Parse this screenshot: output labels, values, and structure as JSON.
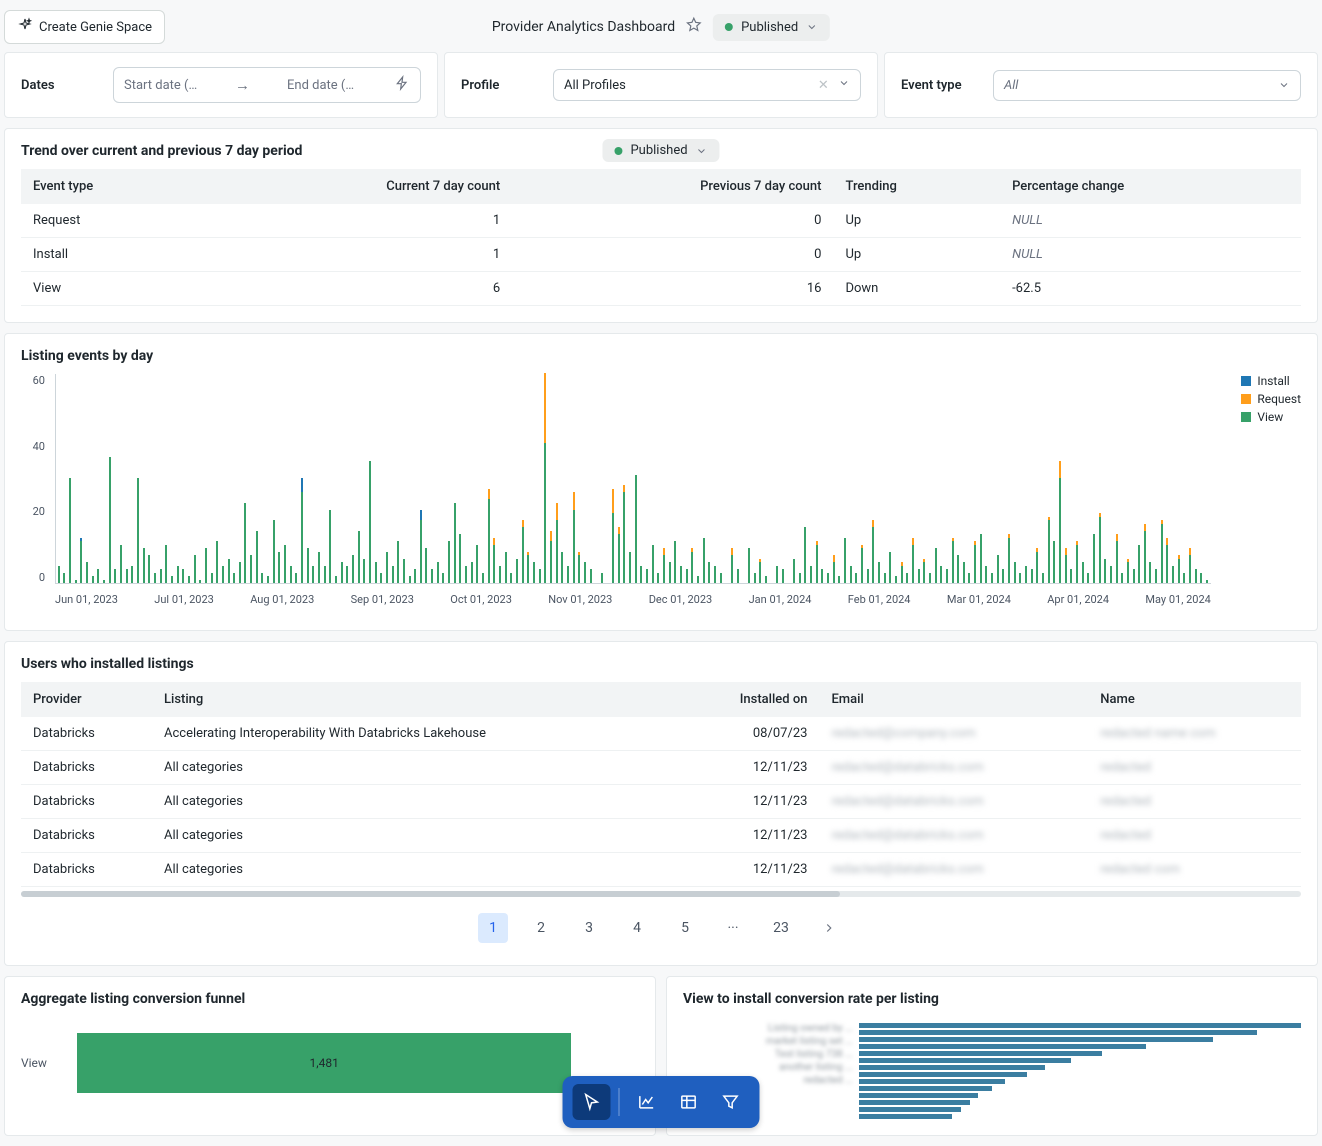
{
  "header": {
    "create_btn": "Create Genie Space",
    "title": "Provider Analytics Dashboard",
    "published": "Published"
  },
  "filters": {
    "dates_label": "Dates",
    "start_placeholder": "Start date (M...",
    "end_placeholder": "End date (M...",
    "profile_label": "Profile",
    "profile_value": "All Profiles",
    "event_type_label": "Event type",
    "event_type_value": "All"
  },
  "trend": {
    "title": "Trend over current and previous 7 day period",
    "published_badge": "Published",
    "headers": [
      "Event type",
      "Current 7 day count",
      "Previous 7 day count",
      "Trending",
      "Percentage change"
    ],
    "rows": [
      {
        "type": "Request",
        "cur": "1",
        "prev": "0",
        "trend": "Up",
        "pct": "NULL"
      },
      {
        "type": "Install",
        "cur": "1",
        "prev": "0",
        "trend": "Up",
        "pct": "NULL"
      },
      {
        "type": "View",
        "cur": "6",
        "prev": "16",
        "trend": "Down",
        "pct": "-62.5"
      }
    ]
  },
  "chart_data": {
    "type": "bar",
    "title": "Listing events by day",
    "ylabel": "",
    "ylim": [
      0,
      60
    ],
    "yticks": [
      0,
      20,
      40,
      60
    ],
    "xticks": [
      "Jun 01, 2023",
      "Jul 01, 2023",
      "Aug 01, 2023",
      "Sep 01, 2023",
      "Oct 01, 2023",
      "Nov 01, 2023",
      "Dec 01, 2023",
      "Jan 01, 2024",
      "Feb 01, 2024",
      "Mar 01, 2024",
      "Apr 01, 2024",
      "May 01, 2024"
    ],
    "legend": [
      "Install",
      "Request",
      "View"
    ],
    "colors": {
      "Install": "#1f77b4",
      "Request": "#ff9e1b",
      "View": "#37a169"
    },
    "series_note": "Daily stacked counts; approximated from chart pixels",
    "data": [
      {
        "v": 5,
        "i": 0,
        "r": 0
      },
      {
        "v": 3,
        "i": 0,
        "r": 0
      },
      {
        "v": 30,
        "i": 0,
        "r": 0
      },
      {
        "v": 1,
        "i": 0,
        "r": 0
      },
      {
        "v": 12,
        "i": 1,
        "r": 0
      },
      {
        "v": 6,
        "i": 0,
        "r": 0
      },
      {
        "v": 2,
        "i": 0,
        "r": 0
      },
      {
        "v": 4,
        "i": 0,
        "r": 0
      },
      {
        "v": 1,
        "i": 0,
        "r": 0
      },
      {
        "v": 36,
        "i": 0,
        "r": 0
      },
      {
        "v": 4,
        "i": 0,
        "r": 0
      },
      {
        "v": 11,
        "i": 0,
        "r": 0
      },
      {
        "v": 4,
        "i": 0,
        "r": 0
      },
      {
        "v": 5,
        "i": 0,
        "r": 0
      },
      {
        "v": 30,
        "i": 0,
        "r": 0
      },
      {
        "v": 10,
        "i": 0,
        "r": 0
      },
      {
        "v": 8,
        "i": 0,
        "r": 0
      },
      {
        "v": 3,
        "i": 0,
        "r": 0
      },
      {
        "v": 4,
        "i": 0,
        "r": 0
      },
      {
        "v": 11,
        "i": 0,
        "r": 0
      },
      {
        "v": 2,
        "i": 0,
        "r": 0
      },
      {
        "v": 5,
        "i": 0,
        "r": 0
      },
      {
        "v": 4,
        "i": 0,
        "r": 0
      },
      {
        "v": 2,
        "i": 0,
        "r": 0
      },
      {
        "v": 8,
        "i": 0,
        "r": 0
      },
      {
        "v": 1,
        "i": 0,
        "r": 0
      },
      {
        "v": 10,
        "i": 0,
        "r": 0
      },
      {
        "v": 3,
        "i": 0,
        "r": 0
      },
      {
        "v": 12,
        "i": 0,
        "r": 0
      },
      {
        "v": 5,
        "i": 0,
        "r": 0
      },
      {
        "v": 7,
        "i": 0,
        "r": 0
      },
      {
        "v": 3,
        "i": 0,
        "r": 0
      },
      {
        "v": 6,
        "i": 0,
        "r": 0
      },
      {
        "v": 23,
        "i": 0,
        "r": 0
      },
      {
        "v": 8,
        "i": 0,
        "r": 0
      },
      {
        "v": 15,
        "i": 0,
        "r": 0
      },
      {
        "v": 3,
        "i": 0,
        "r": 0
      },
      {
        "v": 2,
        "i": 0,
        "r": 0
      },
      {
        "v": 18,
        "i": 0,
        "r": 0
      },
      {
        "v": 9,
        "i": 0,
        "r": 0
      },
      {
        "v": 11,
        "i": 0,
        "r": 0
      },
      {
        "v": 5,
        "i": 0,
        "r": 0
      },
      {
        "v": 3,
        "i": 0,
        "r": 0
      },
      {
        "v": 26,
        "i": 4,
        "r": 0
      },
      {
        "v": 10,
        "i": 0,
        "r": 0
      },
      {
        "v": 5,
        "i": 0,
        "r": 0
      },
      {
        "v": 9,
        "i": 0,
        "r": 0
      },
      {
        "v": 5,
        "i": 0,
        "r": 0
      },
      {
        "v": 21,
        "i": 0,
        "r": 0
      },
      {
        "v": 2,
        "i": 0,
        "r": 0
      },
      {
        "v": 6,
        "i": 0,
        "r": 0
      },
      {
        "v": 5,
        "i": 0,
        "r": 0
      },
      {
        "v": 8,
        "i": 0,
        "r": 0
      },
      {
        "v": 15,
        "i": 0,
        "r": 0
      },
      {
        "v": 7,
        "i": 0,
        "r": 0
      },
      {
        "v": 35,
        "i": 0,
        "r": 0
      },
      {
        "v": 6,
        "i": 0,
        "r": 0
      },
      {
        "v": 3,
        "i": 0,
        "r": 0
      },
      {
        "v": 9,
        "i": 0,
        "r": 0
      },
      {
        "v": 5,
        "i": 0,
        "r": 0
      },
      {
        "v": 12,
        "i": 0,
        "r": 0
      },
      {
        "v": 7,
        "i": 0,
        "r": 0
      },
      {
        "v": 2,
        "i": 0,
        "r": 0
      },
      {
        "v": 4,
        "i": 0,
        "r": 0
      },
      {
        "v": 18,
        "i": 3,
        "r": 0
      },
      {
        "v": 10,
        "i": 0,
        "r": 0
      },
      {
        "v": 4,
        "i": 0,
        "r": 0
      },
      {
        "v": 6,
        "i": 0,
        "r": 0
      },
      {
        "v": 3,
        "i": 0,
        "r": 0
      },
      {
        "v": 12,
        "i": 0,
        "r": 0
      },
      {
        "v": 23,
        "i": 0,
        "r": 0
      },
      {
        "v": 14,
        "i": 0,
        "r": 0
      },
      {
        "v": 5,
        "i": 0,
        "r": 0
      },
      {
        "v": 6,
        "i": 0,
        "r": 0
      },
      {
        "v": 11,
        "i": 0,
        "r": 0
      },
      {
        "v": 3,
        "i": 0,
        "r": 0
      },
      {
        "v": 24,
        "i": 0,
        "r": 3
      },
      {
        "v": 11,
        "i": 0,
        "r": 2
      },
      {
        "v": 5,
        "i": 0,
        "r": 0
      },
      {
        "v": 9,
        "i": 0,
        "r": 0
      },
      {
        "v": 3,
        "i": 0,
        "r": 0
      },
      {
        "v": 7,
        "i": 0,
        "r": 0
      },
      {
        "v": 16,
        "i": 0,
        "r": 2
      },
      {
        "v": 8,
        "i": 0,
        "r": 1
      },
      {
        "v": 6,
        "i": 0,
        "r": 0
      },
      {
        "v": 4,
        "i": 0,
        "r": 0
      },
      {
        "v": 40,
        "i": 0,
        "r": 20
      },
      {
        "v": 12,
        "i": 0,
        "r": 3
      },
      {
        "v": 18,
        "i": 0,
        "r": 5
      },
      {
        "v": 9,
        "i": 0,
        "r": 0
      },
      {
        "v": 5,
        "i": 0,
        "r": 0
      },
      {
        "v": 21,
        "i": 0,
        "r": 5
      },
      {
        "v": 8,
        "i": 0,
        "r": 1
      },
      {
        "v": 6,
        "i": 0,
        "r": 0
      },
      {
        "v": 4,
        "i": 0,
        "r": 0
      },
      {
        "v": 0,
        "i": 0,
        "r": 0
      },
      {
        "v": 3,
        "i": 0,
        "r": 0
      },
      {
        "v": 0,
        "i": 0,
        "r": 0
      },
      {
        "v": 20,
        "i": 0,
        "r": 7
      },
      {
        "v": 14,
        "i": 0,
        "r": 2
      },
      {
        "v": 26,
        "i": 0,
        "r": 2
      },
      {
        "v": 9,
        "i": 0,
        "r": 0
      },
      {
        "v": 31,
        "i": 0,
        "r": 0
      },
      {
        "v": 5,
        "i": 0,
        "r": 0
      },
      {
        "v": 4,
        "i": 0,
        "r": 0
      },
      {
        "v": 11,
        "i": 0,
        "r": 0
      },
      {
        "v": 3,
        "i": 0,
        "r": 0
      },
      {
        "v": 8,
        "i": 0,
        "r": 2
      },
      {
        "v": 6,
        "i": 0,
        "r": 0
      },
      {
        "v": 12,
        "i": 0,
        "r": 0
      },
      {
        "v": 5,
        "i": 0,
        "r": 0
      },
      {
        "v": 4,
        "i": 0,
        "r": 0
      },
      {
        "v": 9,
        "i": 0,
        "r": 1
      },
      {
        "v": 2,
        "i": 0,
        "r": 0
      },
      {
        "v": 13,
        "i": 0,
        "r": 0
      },
      {
        "v": 6,
        "i": 0,
        "r": 0
      },
      {
        "v": 5,
        "i": 0,
        "r": 0
      },
      {
        "v": 3,
        "i": 0,
        "r": 0
      },
      {
        "v": 0,
        "i": 0,
        "r": 0
      },
      {
        "v": 8,
        "i": 0,
        "r": 2
      },
      {
        "v": 4,
        "i": 0,
        "r": 0
      },
      {
        "v": 0,
        "i": 0,
        "r": 0
      },
      {
        "v": 10,
        "i": 0,
        "r": 0
      },
      {
        "v": 3,
        "i": 0,
        "r": 0
      },
      {
        "v": 6,
        "i": 0,
        "r": 1
      },
      {
        "v": 2,
        "i": 0,
        "r": 0
      },
      {
        "v": 0,
        "i": 0,
        "r": 0
      },
      {
        "v": 5,
        "i": 0,
        "r": 0
      },
      {
        "v": 4,
        "i": 0,
        "r": 0
      },
      {
        "v": 0,
        "i": 0,
        "r": 0
      },
      {
        "v": 7,
        "i": 0,
        "r": 0
      },
      {
        "v": 3,
        "i": 0,
        "r": 0
      },
      {
        "v": 16,
        "i": 0,
        "r": 0
      },
      {
        "v": 5,
        "i": 0,
        "r": 0
      },
      {
        "v": 11,
        "i": 0,
        "r": 1
      },
      {
        "v": 4,
        "i": 0,
        "r": 0
      },
      {
        "v": 3,
        "i": 0,
        "r": 0
      },
      {
        "v": 6,
        "i": 0,
        "r": 2
      },
      {
        "v": 2,
        "i": 0,
        "r": 0
      },
      {
        "v": 13,
        "i": 0,
        "r": 0
      },
      {
        "v": 5,
        "i": 0,
        "r": 0
      },
      {
        "v": 3,
        "i": 0,
        "r": 0
      },
      {
        "v": 10,
        "i": 0,
        "r": 1
      },
      {
        "v": 4,
        "i": 0,
        "r": 0
      },
      {
        "v": 16,
        "i": 0,
        "r": 2
      },
      {
        "v": 6,
        "i": 0,
        "r": 0
      },
      {
        "v": 3,
        "i": 0,
        "r": 0
      },
      {
        "v": 9,
        "i": 0,
        "r": 0
      },
      {
        "v": 2,
        "i": 0,
        "r": 0
      },
      {
        "v": 5,
        "i": 0,
        "r": 1
      },
      {
        "v": 3,
        "i": 0,
        "r": 0
      },
      {
        "v": 11,
        "i": 0,
        "r": 2
      },
      {
        "v": 4,
        "i": 0,
        "r": 0
      },
      {
        "v": 6,
        "i": 0,
        "r": 1
      },
      {
        "v": 3,
        "i": 0,
        "r": 0
      },
      {
        "v": 10,
        "i": 0,
        "r": 0
      },
      {
        "v": 5,
        "i": 0,
        "r": 0
      },
      {
        "v": 4,
        "i": 0,
        "r": 0
      },
      {
        "v": 12,
        "i": 0,
        "r": 1
      },
      {
        "v": 8,
        "i": 0,
        "r": 0
      },
      {
        "v": 6,
        "i": 0,
        "r": 0
      },
      {
        "v": 3,
        "i": 0,
        "r": 0
      },
      {
        "v": 11,
        "i": 0,
        "r": 1
      },
      {
        "v": 14,
        "i": 0,
        "r": 0
      },
      {
        "v": 5,
        "i": 0,
        "r": 0
      },
      {
        "v": 3,
        "i": 0,
        "r": 0
      },
      {
        "v": 8,
        "i": 0,
        "r": 0
      },
      {
        "v": 4,
        "i": 0,
        "r": 0
      },
      {
        "v": 13,
        "i": 0,
        "r": 1
      },
      {
        "v": 6,
        "i": 0,
        "r": 0
      },
      {
        "v": 3,
        "i": 0,
        "r": 0
      },
      {
        "v": 5,
        "i": 0,
        "r": 0
      },
      {
        "v": 4,
        "i": 0,
        "r": 0
      },
      {
        "v": 9,
        "i": 0,
        "r": 1
      },
      {
        "v": 3,
        "i": 0,
        "r": 0
      },
      {
        "v": 18,
        "i": 0,
        "r": 1
      },
      {
        "v": 12,
        "i": 0,
        "r": 0
      },
      {
        "v": 30,
        "i": 0,
        "r": 5
      },
      {
        "v": 8,
        "i": 0,
        "r": 2
      },
      {
        "v": 4,
        "i": 0,
        "r": 0
      },
      {
        "v": 11,
        "i": 0,
        "r": 1
      },
      {
        "v": 6,
        "i": 0,
        "r": 0
      },
      {
        "v": 3,
        "i": 0,
        "r": 0
      },
      {
        "v": 14,
        "i": 0,
        "r": 0
      },
      {
        "v": 19,
        "i": 0,
        "r": 1
      },
      {
        "v": 7,
        "i": 0,
        "r": 0
      },
      {
        "v": 5,
        "i": 0,
        "r": 0
      },
      {
        "v": 12,
        "i": 0,
        "r": 2
      },
      {
        "v": 3,
        "i": 0,
        "r": 0
      },
      {
        "v": 6,
        "i": 0,
        "r": 1
      },
      {
        "v": 4,
        "i": 0,
        "r": 0
      },
      {
        "v": 11,
        "i": 0,
        "r": 0
      },
      {
        "v": 15,
        "i": 0,
        "r": 2
      },
      {
        "v": 6,
        "i": 0,
        "r": 0
      },
      {
        "v": 4,
        "i": 0,
        "r": 0
      },
      {
        "v": 17,
        "i": 0,
        "r": 1
      },
      {
        "v": 11,
        "i": 0,
        "r": 2
      },
      {
        "v": 5,
        "i": 0,
        "r": 0
      },
      {
        "v": 7,
        "i": 0,
        "r": 1
      },
      {
        "v": 3,
        "i": 0,
        "r": 0
      },
      {
        "v": 8,
        "i": 0,
        "r": 2
      },
      {
        "v": 4,
        "i": 0,
        "r": 0
      },
      {
        "v": 3,
        "i": 0,
        "r": 0
      },
      {
        "v": 1,
        "i": 0,
        "r": 0
      }
    ]
  },
  "installs": {
    "title": "Users who installed listings",
    "headers": [
      "Provider",
      "Listing",
      "Installed on",
      "Email",
      "Name"
    ],
    "rows": [
      {
        "provider": "Databricks",
        "listing": "Accelerating Interoperability With Databricks Lakehouse",
        "date": "08/07/23",
        "email": "redacted@company.com",
        "name": "redacted name com"
      },
      {
        "provider": "Databricks",
        "listing": "All categories",
        "date": "12/11/23",
        "email": "redacted@databricks.com",
        "name": "redacted"
      },
      {
        "provider": "Databricks",
        "listing": "All categories",
        "date": "12/11/23",
        "email": "redacted@databricks.com",
        "name": "redacted"
      },
      {
        "provider": "Databricks",
        "listing": "All categories",
        "date": "12/11/23",
        "email": "redacted@databricks.com",
        "name": "redacted"
      },
      {
        "provider": "Databricks",
        "listing": "All categories",
        "date": "12/11/23",
        "email": "redacted@databricks.com",
        "name": "redacted com"
      }
    ],
    "pages": [
      "1",
      "2",
      "3",
      "4",
      "5",
      "···",
      "23"
    ]
  },
  "funnel": {
    "title": "Aggregate listing conversion funnel",
    "row_label": "View",
    "row_value": "1,481"
  },
  "conversion": {
    "title": "View to install conversion rate per listing",
    "labels": [
      "Listing owned by ...",
      "market listing set ...",
      "Test listing 738 ...",
      "another listing ...",
      "redacted ..."
    ],
    "values": [
      100,
      90,
      80,
      65,
      55,
      48,
      42,
      38,
      33,
      30,
      27,
      25,
      23,
      21
    ]
  }
}
